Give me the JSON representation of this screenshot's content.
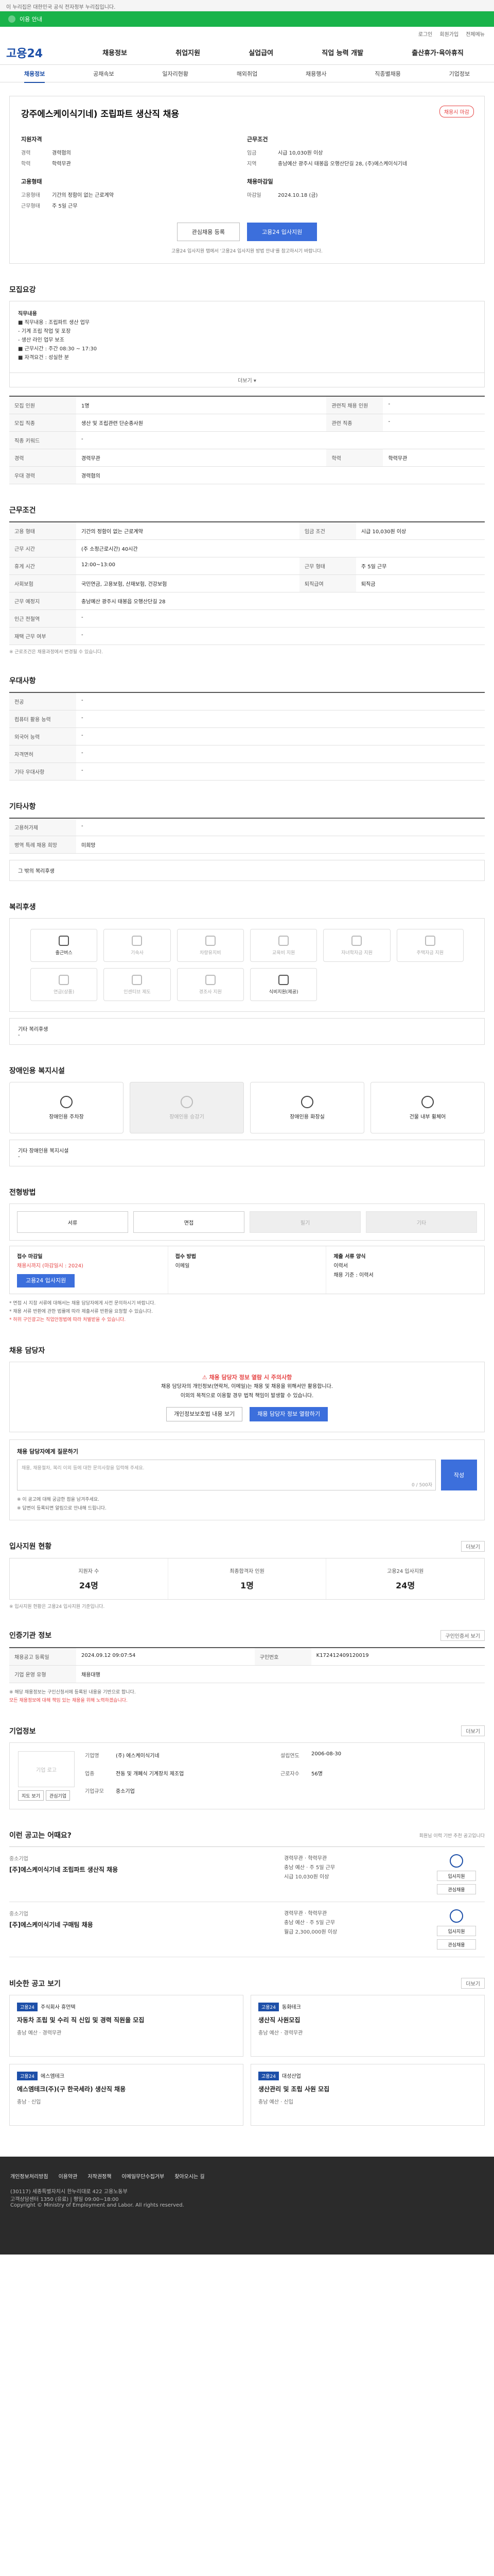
{
  "topbar": {
    "text": "이 누리집은 대한민국 공식 전자정부 누리집입니다."
  },
  "greenbar": {
    "text": "이용 안내"
  },
  "util": {
    "items": [
      "로그인",
      "회원가입",
      "전체메뉴"
    ]
  },
  "gnb": {
    "logo": "고용24",
    "menu": [
      "채용정보",
      "취업지원",
      "실업급여",
      "직업 능력 개발",
      "출산휴가·육아휴직"
    ]
  },
  "subnav": {
    "items": [
      "채용정보",
      "공채속보",
      "일자리현황",
      "해외취업",
      "채용행사",
      "직종별채용",
      "기업정보"
    ],
    "active": 0
  },
  "job": {
    "title": "강주에스케이식기네) 조립파트 생산직 채용",
    "stage": "채용시 마감",
    "req_head": "지원자격",
    "req_rows": [
      {
        "k": "경력",
        "v": "경력협의"
      },
      {
        "k": "학력",
        "v": "학력무관"
      }
    ],
    "cond_head": "근무조건",
    "cond_rows": [
      {
        "k": "임금",
        "v": "시급 10,030원 이상"
      },
      {
        "k": "지역",
        "v": "충남예산 광주시 태봉읍 오행산단길 28, (주)에스케이식기네"
      }
    ],
    "emp_head": "고용형태",
    "emp_rows": [
      {
        "k": "고용형태",
        "v": "기간의 정함이 없는 근로계약"
      },
      {
        "k": "근무형태",
        "v": "주 5일 근무"
      }
    ],
    "deadline_head": "채용마감일",
    "deadline_rows": [
      {
        "k": "마감일",
        "v": "2024.10.18 (금)"
      }
    ],
    "btn_scrap": "관심채용 등록",
    "btn_apply": "고용24 입사지원",
    "notice": "고용24 입사지원 탭에서 '고용24 입사지원 방법 안내'를 참고하시기 바랍니다."
  },
  "sections": {
    "recruit": "모집요강",
    "work": "근무조건",
    "eligibility": "우대사항",
    "other": "기타사항",
    "welfare": "복리후생",
    "facility": "장애인용 복지시설",
    "process": "전형방법",
    "contact": "채용 담당자",
    "stats": "입사지원 현황",
    "manager": "인증기관 정보",
    "company": "기업정보",
    "recommend": "이런 공고는 어때요?",
    "similar": "비슷한 공고 보기"
  },
  "recruit": {
    "desc_lines": [
      "직무내용",
      "■ 직무내용 : 조립파트 생산 업무",
      "  - 기계 조립 작업 및 포장",
      "  - 생산 라인 업무 보조",
      "■ 근무시간 : 주간 08:30 ~ 17:30",
      "■ 자격요건 : 성실한 분"
    ],
    "toggle": "더보기",
    "rows": [
      {
        "k": "모집 인원",
        "v": "1명",
        "k2": "관련직 채용 인원",
        "v2": "-"
      },
      {
        "k": "모집 직종",
        "v": "생산 및 조립관련 단순종사원",
        "k2": "관련 직종",
        "v2": "-"
      },
      {
        "k": "직종 키워드",
        "v": "-",
        "k2": "",
        "v2": ""
      },
      {
        "k": "경력",
        "v": "경력무관",
        "k2": "학력",
        "v2": "학력무관"
      },
      {
        "k": "우대 경력",
        "v": "경력협의",
        "k2": "",
        "v2": ""
      }
    ]
  },
  "work": {
    "rows": [
      {
        "k": "고용 형태",
        "v": "기간의 정함이 없는 근로계약",
        "k2": "임금 조건",
        "v2": "시급 10,030원 이상"
      },
      {
        "k": "근무 시간",
        "v": "(주 소정근로시간) 40시간",
        "k2": "",
        "v2": ""
      },
      {
        "k": "휴게 시간",
        "v": "12:00~13:00",
        "k2": "근무 형태",
        "v2": "주 5일 근무"
      },
      {
        "k": "사회보험",
        "v": "국민연금, 고용보험, 산재보험, 건강보험",
        "k2": "퇴직급여",
        "v2": "퇴직금"
      },
      {
        "k": "근무 예정지",
        "v": "충남예산 광주시 태봉읍 오행산단길 28",
        "k2": "",
        "v2": ""
      },
      {
        "k": "인근 전철역",
        "v": "-",
        "k2": "",
        "v2": ""
      },
      {
        "k": "재택 근무 여부",
        "v": "-",
        "k2": "",
        "v2": ""
      }
    ],
    "note": "※ 근로조건은 채용과정에서 변경될 수 있습니다."
  },
  "eligibility": {
    "rows": [
      {
        "k": "전공",
        "v": "-"
      },
      {
        "k": "컴퓨터 활용 능력",
        "v": "-"
      },
      {
        "k": "외국어 능력",
        "v": "-"
      },
      {
        "k": "자격면허",
        "v": "-"
      },
      {
        "k": "기타 우대사항",
        "v": "-"
      }
    ]
  },
  "other": {
    "rows": [
      {
        "k": "고용허가제",
        "v": "-"
      },
      {
        "k": "병역 특례 채용 희망",
        "v": "미희망"
      }
    ],
    "box": "그 밖의 복리후생"
  },
  "welfare": {
    "items": [
      {
        "label": "출근버스",
        "on": true
      },
      {
        "label": "기숙사",
        "on": false
      },
      {
        "label": "차량유지비",
        "on": false
      },
      {
        "label": "교육비 지원",
        "on": false
      },
      {
        "label": "자녀학자금 지원",
        "on": false
      },
      {
        "label": "주택자금 지원",
        "on": false
      },
      {
        "label": "연금(상품)",
        "on": false
      },
      {
        "label": "인센티브 제도",
        "on": false
      },
      {
        "label": "경조사 지원",
        "on": false
      },
      {
        "label": "식비지원(제공)",
        "on": true
      }
    ],
    "box": "기타 복리후생",
    "box_value": "-"
  },
  "facility": {
    "items": [
      {
        "label": "장애인용 주차장",
        "on": true
      },
      {
        "label": "장애인용 승강기",
        "on": false
      },
      {
        "label": "장애인용 화장실",
        "on": true
      },
      {
        "label": "건물 내부 휠체어",
        "on": true
      }
    ],
    "box": "기타 장애인용 복지시설",
    "box_value": "-"
  },
  "process": {
    "methods": [
      {
        "label": "서류",
        "on": true
      },
      {
        "label": "면접",
        "on": true
      },
      {
        "label": "필기",
        "on": false
      },
      {
        "label": "기타",
        "on": false
      }
    ],
    "cols": [
      [
        "접수 마감일",
        "채용시까지 (마감일시 : 2024)",
        "고용24 입사지원"
      ],
      [
        "접수 방법",
        "이메일",
        ""
      ],
      [
        "제출 서류 양식",
        "이력서",
        "채용 기준 : 이력서"
      ]
    ],
    "bullets": [
      "* 면접 시 지참 서류에 대해서는 채용 담당자에게 사전 문의하시기 바랍니다.",
      "* 채용 서류 반환에 관한 법률에 따라 제출서류 반환을 요청할 수 있습니다.",
      "* 허위 구인광고는 직업안정법에 따라 처벌받을 수 있습니다."
    ]
  },
  "contact": {
    "warn": "채용 담당자 정보 열람 시 주의사항",
    "line1": "채용 담당자의 개인정보(연락처, 이메일)는 채용 및 채용을 위해서만 활용합니다.",
    "line2": "이외의 목적으로 이용할 경우 법적 책임이 발생할 수 있습니다.",
    "btn_view": "개인정보보호법 내용 보기",
    "btn_info": "채용 담당자 정보 열람하기",
    "qa_title": "채용 담당자에게 질문하기",
    "qa_placeholder": "채용, 채용절차, 복리 이외 등에 대한 문의사항을 입력해 주세요.",
    "qa_count": "0 / 500자",
    "qa_submit": "작성",
    "qa_notes": [
      "※ 이 공고에 대해 궁금한 점을 남겨주세요.",
      "※ 답변이 등록되면 알림으로 안내해 드립니다."
    ]
  },
  "stats": {
    "more": "더보기",
    "items": [
      {
        "label": "지원자 수",
        "value": "24명"
      },
      {
        "label": "최종합격자 인원",
        "value": "1명"
      },
      {
        "label": "고용24 입사지원",
        "value": "24명"
      }
    ],
    "note": "※ 입사지원 현황은 고용24 입사지원 기준입니다."
  },
  "manager": {
    "btn": "구인인증서 보기",
    "rows": [
      {
        "k": "채용공고 등록일",
        "v": "2024.09.12 09:07:54",
        "k2": "구인번호",
        "v2": "K172412409120019"
      },
      {
        "k": "기업 운영 유형",
        "v": "채용대행",
        "k2": "",
        "v2": ""
      }
    ],
    "note": "※ 해당 채용정보는 구인신청서에 등록된 내용을 기반으로 합니다.",
    "link_note": "모든 채용정보에 대해 책임 있는 채용을 위해 노력하겠습니다."
  },
  "company": {
    "more": "더보기",
    "logo_text": "기업 로고",
    "btn_map": "지도 보기",
    "btn_fav": "관심기업",
    "rows": [
      {
        "k": "기업명",
        "v": "(주) 에스케이식기네",
        "k2": "설립연도",
        "v2": "2006-08-30"
      },
      {
        "k": "업종",
        "v": "전동 및 개폐식 기계장치 제조업",
        "k2": "근로자수",
        "v2": "56명"
      },
      {
        "k": "기업규모",
        "v": "중소기업",
        "k2": "",
        "v2": ""
      }
    ]
  },
  "recommend": {
    "note": "회원님 이력 기반 추천 공고입니다",
    "items": [
      {
        "company": "중소기업",
        "title": "[주]에스케이식기네 조립파트 생산직 채용",
        "meta": [
          "경력무관",
          "학력무관",
          "충남 예산",
          "주 5일 근무",
          "시급 10,030원 이상"
        ],
        "btns": [
          "입사지원",
          "관심채용"
        ]
      },
      {
        "company": "중소기업",
        "title": "[주]에스케이식기네 구매팀 채용",
        "meta": [
          "경력무관",
          "학력무관",
          "충남 예산",
          "주 5일 근무",
          "월급 2,300,000원 이상"
        ],
        "btns": [
          "입사지원",
          "관심채용"
        ]
      }
    ]
  },
  "similar": {
    "more": "더보기",
    "cards": [
      {
        "tag": "고용24",
        "company": "주식회사 휴먼텍",
        "title": "자동차 조립 및 수리 직 신입 및 경력 직원을 모집",
        "meta": "충남 예산 · 경력무관"
      },
      {
        "tag": "고용24",
        "company": "동화테크",
        "title": "생산직 사원모집",
        "meta": "충남 예산 · 경력무관"
      },
      {
        "tag": "고용24",
        "company": "에스엠테크",
        "title": "에스엠테크(주)(구 한국세라) 생산직 채용",
        "meta": "충남 · 신입"
      },
      {
        "tag": "고용24",
        "company": "대성산업",
        "title": "생산관리 및 조립 사원 모집",
        "meta": "충남 예산 · 신입"
      }
    ]
  },
  "footer": {
    "links": [
      "개인정보처리방침",
      "이용약관",
      "저작권정책",
      "이메일무단수집거부",
      "찾아오시는 길"
    ],
    "lines": [
      "(30117) 세종특별자치시 한누리대로 422 고용노동부",
      "고객상담센터 1350 (유료) | 평일 09:00~18:00",
      "Copyright © Ministry of Employment and Labor. All rights reserved."
    ]
  }
}
